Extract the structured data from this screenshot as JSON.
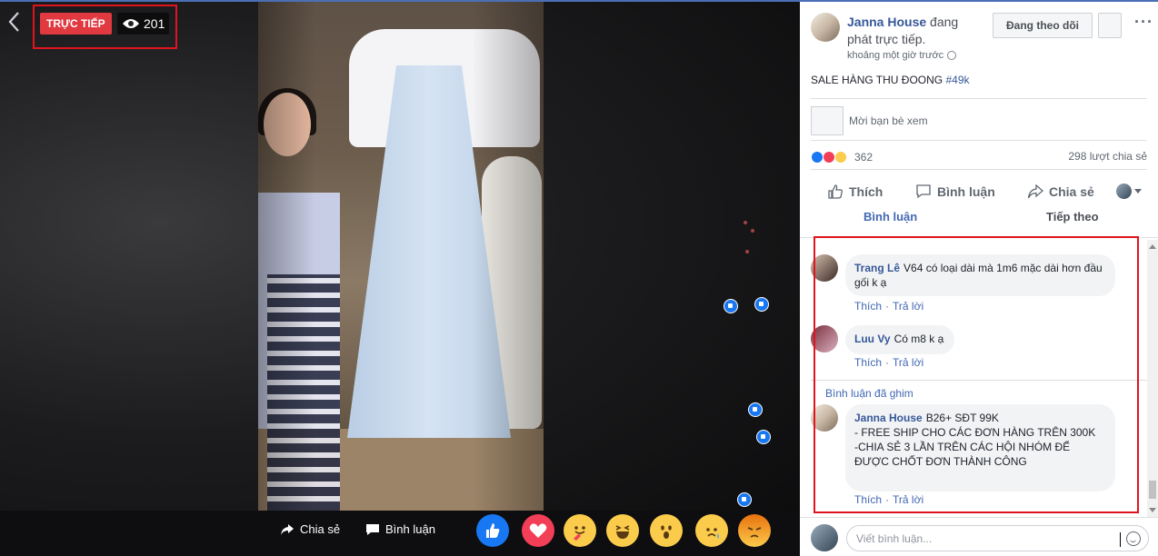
{
  "live": {
    "badge": "TRỰC TIẾP",
    "viewers": "201"
  },
  "video_bar": {
    "share_label": "Chia sẻ",
    "comment_label": "Bình luận"
  },
  "poster": {
    "name": "Janna House",
    "status": "đang phát trực tiếp.",
    "time": "khoảng một giờ trước",
    "follow_label": "Đang theo dõi"
  },
  "caption": {
    "text": "SALE HÀNG THU ĐOONG ",
    "hashtag": "#49k"
  },
  "invite": {
    "placeholder": "Mời bạn bè xem"
  },
  "stats": {
    "reactions": "362",
    "shares": "298 lượt chia sẻ"
  },
  "actions": {
    "like": "Thích",
    "comment": "Bình luận",
    "share": "Chia sẻ"
  },
  "tabs": {
    "comments": "Bình luận",
    "next": "Tiếp theo"
  },
  "comments": [
    {
      "author": "Trang Lê",
      "text": "V64 có loại dài mà 1m6 mặc dài hơn đầu gối k ạ",
      "like": "Thích",
      "reply": "Trả lời"
    },
    {
      "author": "Luu Vy",
      "text": "Có m8 k ạ",
      "like": "Thích",
      "reply": "Trả lời"
    }
  ],
  "pinned": {
    "label": "Bình luận đã ghim",
    "author": "Janna House",
    "line1": "B26+ SĐT 99K",
    "line2": "- FREE SHIP CHO CÁC ĐƠN HÀNG TRÊN 300K",
    "line3": "-CHIA SẺ 3 LẦN TRÊN CÁC HỘI NHÓM ĐỂ ĐƯỢC CHỐT ĐƠN THÀNH CÔNG",
    "like": "Thích",
    "reply": "Trả lời"
  },
  "compose": {
    "placeholder": "Viết bình luận..."
  },
  "colors": {
    "live_red": "#e0393f",
    "link_blue": "#365899",
    "highlight_red": "#e0141e",
    "fb_blue": "#1877f2"
  },
  "icons": [
    "back-arrow-icon",
    "eye-icon",
    "share-icon",
    "comment-icon",
    "like-icon",
    "globe-icon",
    "more-icon",
    "smile-icon"
  ]
}
